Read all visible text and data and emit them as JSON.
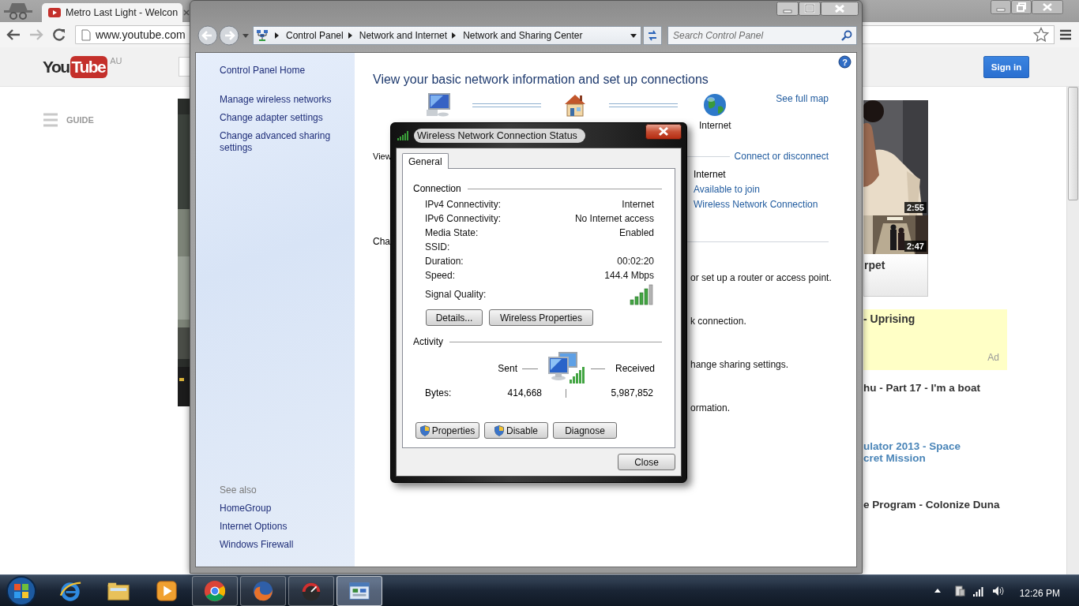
{
  "browser": {
    "tab": {
      "title": "Metro Last Light - Welcon",
      "selected": true
    },
    "url": "www.youtube.com"
  },
  "youtube": {
    "logo": [
      "You",
      "Tube"
    ],
    "region": "AU",
    "sign_in": "Sign in",
    "guide": "GUIDE",
    "thumbnails": [
      {
        "duration": "2:55"
      },
      {
        "duration": "2:47"
      }
    ],
    "card_title": "rpet",
    "ad": {
      "title": "- Uprising",
      "label": "Ad"
    },
    "items": [
      {
        "kind": "plain",
        "lines": [
          "hu - Part 17 - I'm a boat"
        ]
      },
      {
        "kind": "link",
        "lines": [
          "ulator 2013 - Space",
          "cret Mission"
        ]
      },
      {
        "kind": "plain",
        "lines": [
          "e Program - Colonize Duna"
        ]
      }
    ]
  },
  "control_panel": {
    "breadcrumb": [
      "Control Panel",
      "Network and Internet",
      "Network and Sharing Center"
    ],
    "search": {
      "placeholder": "Search Control Panel"
    },
    "help": "?",
    "sidebar": {
      "home": "Control Panel Home",
      "tasks": [
        "Manage wireless networks",
        "Change adapter settings",
        "Change advanced sharing settings"
      ],
      "see_also": {
        "heading": "See also",
        "items": [
          "HomeGroup",
          "Internet Options",
          "Windows Firewall"
        ]
      }
    },
    "main": {
      "title": "View your basic network information and set up connections",
      "see_full_map": "See full map",
      "map": [
        {
          "kind": "pc"
        },
        {
          "kind": "house"
        },
        {
          "kind": "globe",
          "label": "Internet"
        }
      ],
      "view_label": "View",
      "connect_link": "Connect or disconnect",
      "access_type": "Internet",
      "homegroup_link": "Available to join",
      "connection_link": "Wireless Network Connection",
      "change_label": "Cha",
      "tasks": [
        "or set up a router or access point.",
        "k connection.",
        "hange sharing settings.",
        "ormation."
      ]
    }
  },
  "dialog": {
    "title": "Wireless Network Connection Status",
    "tabs": [
      {
        "label": "General",
        "selected": true
      }
    ],
    "connection": {
      "heading": "Connection",
      "rows": [
        {
          "label": "IPv4 Connectivity:",
          "value": "Internet"
        },
        {
          "label": "IPv6 Connectivity:",
          "value": "No Internet access"
        },
        {
          "label": "Media State:",
          "value": "Enabled"
        },
        {
          "label": "SSID:"
        },
        {
          "label": "Duration:",
          "value": "00:02:20"
        },
        {
          "label": "Speed:",
          "value": "144.4 Mbps"
        }
      ],
      "signal_label": "Signal Quality:"
    },
    "buttons": [
      "Details...",
      "Wireless Properties"
    ],
    "activity": {
      "heading": "Activity",
      "sent": "Sent",
      "received": "Received",
      "bytes_label": "Bytes:",
      "bytes_sent": "414,668",
      "bytes_received": "5,987,852"
    },
    "bottom_buttons": [
      {
        "label": "Properties",
        "shield": true
      },
      {
        "label": "Disable",
        "shield": true
      },
      {
        "label": "Diagnose",
        "shield": false
      }
    ],
    "close": "Close"
  },
  "taskbar": {
    "apps": [
      {
        "kind": "ie",
        "running": false,
        "selected": false
      },
      {
        "kind": "explorer",
        "running": false,
        "selected": false
      },
      {
        "kind": "media",
        "running": false,
        "selected": false
      },
      {
        "kind": "chrome",
        "running": true,
        "selected": false
      },
      {
        "kind": "firefox",
        "running": true,
        "selected": false
      },
      {
        "kind": "app",
        "running": true,
        "selected": false
      },
      {
        "kind": "control-panel",
        "running": true,
        "selected": true
      }
    ],
    "clock": "12:26 PM"
  }
}
